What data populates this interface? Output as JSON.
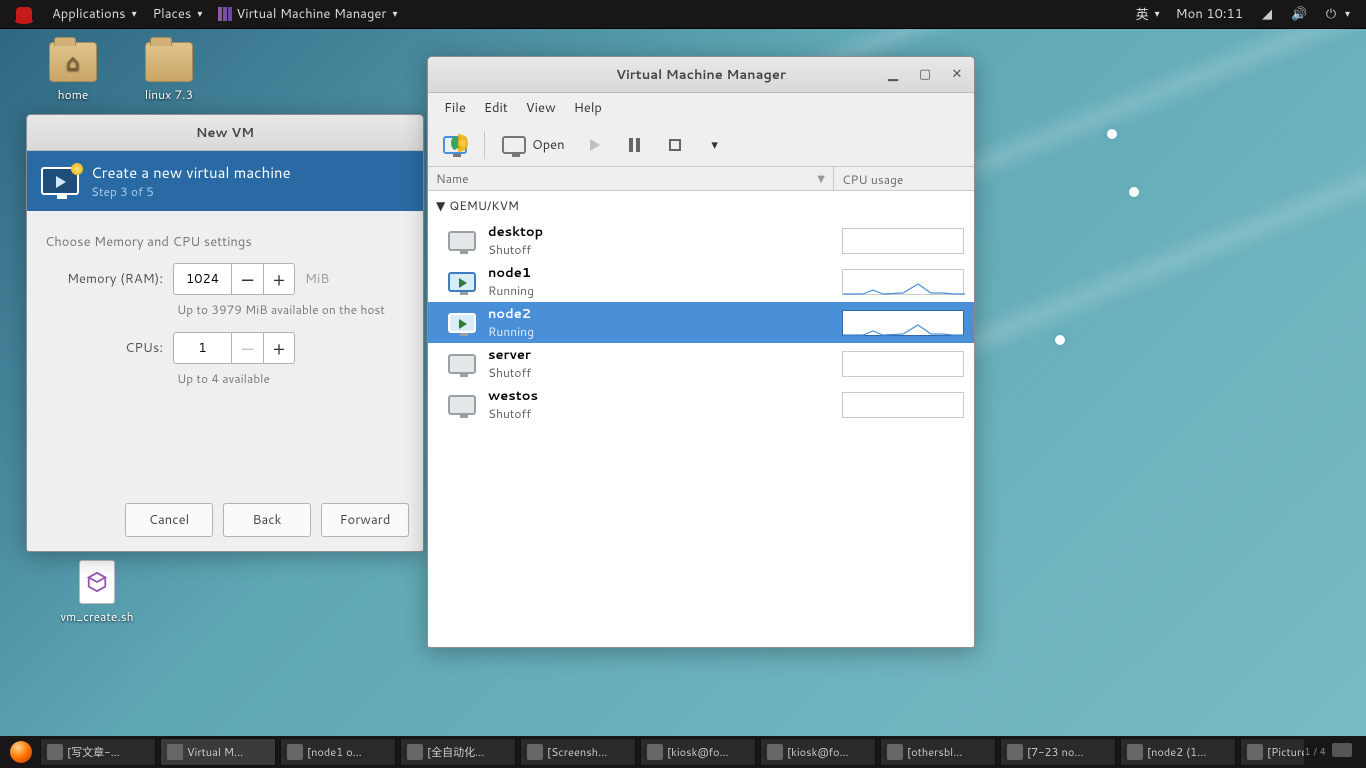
{
  "topbar": {
    "applications": "Applications",
    "places": "Places",
    "app_title": "Virtual Machine Manager",
    "ime": "英",
    "clock": "Mon 10:11"
  },
  "desktop": {
    "home": "home",
    "folder2": "linux 7.3",
    "script": "vm_create.sh"
  },
  "wizard": {
    "window_title": "New VM",
    "title": "Create a new virtual machine",
    "step": "Step 3 of 5",
    "section": "Choose Memory and CPU settings",
    "memory_label": "Memory (RAM):",
    "memory_value": "1024",
    "memory_unit": "MiB",
    "memory_hint": "Up to 3979 MiB available on the host",
    "cpus_label": "CPUs:",
    "cpus_value": "1",
    "cpus_hint": "Up to 4 available",
    "cancel": "Cancel",
    "back": "Back",
    "forward": "Forward"
  },
  "vmm": {
    "title": "Virtual Machine Manager",
    "menu": {
      "file": "File",
      "edit": "Edit",
      "view": "View",
      "help": "Help"
    },
    "open": "Open",
    "col_name": "Name",
    "col_cpu": "CPU usage",
    "conn": "QEMU/KVM",
    "vms": [
      {
        "name": "desktop",
        "state": "Shutoff",
        "running": false,
        "selected": false
      },
      {
        "name": "node1",
        "state": "Running",
        "running": true,
        "selected": false
      },
      {
        "name": "node2",
        "state": "Running",
        "running": true,
        "selected": true
      },
      {
        "name": "server",
        "state": "Shutoff",
        "running": false,
        "selected": false
      },
      {
        "name": "westos",
        "state": "Shutoff",
        "running": false,
        "selected": false
      }
    ]
  },
  "taskbar": {
    "tasks": [
      "[写文章-…",
      "Virtual M…",
      "[node1 o…",
      "[全自动化…",
      "[Screensh…",
      "[kiosk@fo…",
      "[kiosk@fo…",
      "[othersbl…",
      "[7-23 no…",
      "[node2 (1…",
      "[Pictures]"
    ],
    "ws": "1 / 4"
  }
}
